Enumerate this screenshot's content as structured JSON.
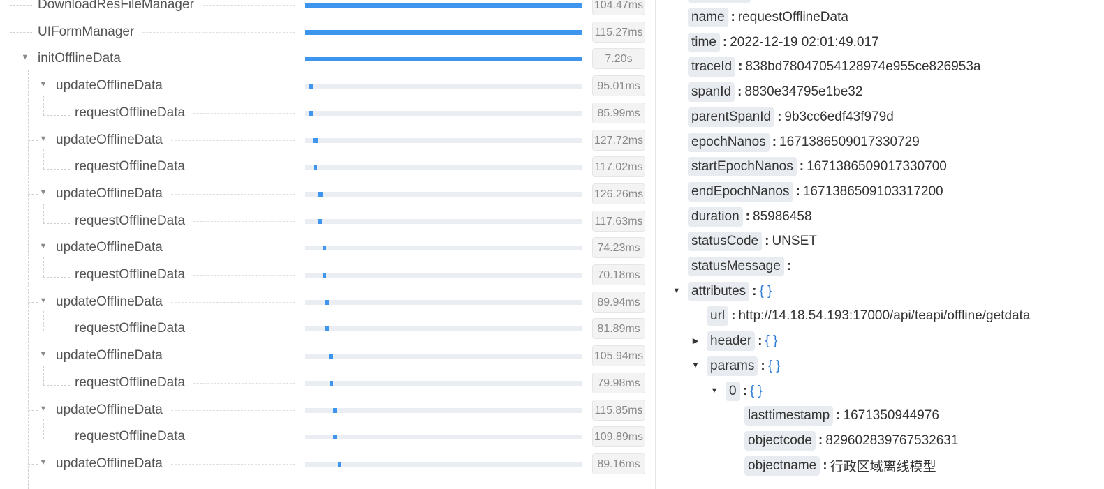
{
  "trace_tree": {
    "rows": [
      {
        "name": "DownloadResFileManager",
        "duration": "104.47ms",
        "depth": 0,
        "toggle": "none",
        "bar_start": 0.0,
        "bar_fill": 1.0,
        "partial": true
      },
      {
        "name": "UIFormManager",
        "duration": "115.27ms",
        "depth": 0,
        "toggle": "none",
        "bar_start": 0.0,
        "bar_fill": 1.0
      },
      {
        "name": "initOfflineData",
        "duration": "7.20s",
        "depth": 0,
        "toggle": "expanded",
        "bar_start": 0.0,
        "bar_fill": 1.0
      },
      {
        "name": "updateOfflineData",
        "duration": "95.01ms",
        "depth": 1,
        "toggle": "expanded",
        "bar_start": 0.015,
        "bar_fill": 0.013
      },
      {
        "name": "requestOfflineData",
        "duration": "85.99ms",
        "depth": 2,
        "toggle": "none",
        "bar_start": 0.016,
        "bar_fill": 0.011
      },
      {
        "name": "updateOfflineData",
        "duration": "127.72ms",
        "depth": 1,
        "toggle": "expanded",
        "bar_start": 0.028,
        "bar_fill": 0.017
      },
      {
        "name": "requestOfflineData",
        "duration": "117.02ms",
        "depth": 2,
        "toggle": "none",
        "bar_start": 0.029,
        "bar_fill": 0.015
      },
      {
        "name": "updateOfflineData",
        "duration": "126.26ms",
        "depth": 1,
        "toggle": "expanded",
        "bar_start": 0.045,
        "bar_fill": 0.017
      },
      {
        "name": "requestOfflineData",
        "duration": "117.63ms",
        "depth": 2,
        "toggle": "none",
        "bar_start": 0.046,
        "bar_fill": 0.015
      },
      {
        "name": "updateOfflineData",
        "duration": "74.23ms",
        "depth": 1,
        "toggle": "expanded",
        "bar_start": 0.063,
        "bar_fill": 0.01
      },
      {
        "name": "requestOfflineData",
        "duration": "70.18ms",
        "depth": 2,
        "toggle": "none",
        "bar_start": 0.063,
        "bar_fill": 0.009
      },
      {
        "name": "updateOfflineData",
        "duration": "89.94ms",
        "depth": 1,
        "toggle": "expanded",
        "bar_start": 0.073,
        "bar_fill": 0.012
      },
      {
        "name": "requestOfflineData",
        "duration": "81.89ms",
        "depth": 2,
        "toggle": "none",
        "bar_start": 0.074,
        "bar_fill": 0.011
      },
      {
        "name": "updateOfflineData",
        "duration": "105.94ms",
        "depth": 1,
        "toggle": "expanded",
        "bar_start": 0.086,
        "bar_fill": 0.014
      },
      {
        "name": "requestOfflineData",
        "duration": "79.98ms",
        "depth": 2,
        "toggle": "none",
        "bar_start": 0.087,
        "bar_fill": 0.011
      },
      {
        "name": "updateOfflineData",
        "duration": "115.85ms",
        "depth": 1,
        "toggle": "expanded",
        "bar_start": 0.101,
        "bar_fill": 0.015
      },
      {
        "name": "requestOfflineData",
        "duration": "109.89ms",
        "depth": 2,
        "toggle": "none",
        "bar_start": 0.102,
        "bar_fill": 0.014
      },
      {
        "name": "updateOfflineData",
        "duration": "89.16ms",
        "depth": 1,
        "toggle": "expanded",
        "bar_start": 0.118,
        "bar_fill": 0.012
      }
    ]
  },
  "details": {
    "rows": [
      {
        "key": "name",
        "value": "requestOfflineData",
        "indent": 0
      },
      {
        "key": "time",
        "value": "2022-12-19 02:01:49.017",
        "indent": 0
      },
      {
        "key": "traceId",
        "value": "838bd78047054128974e955ce826953a",
        "indent": 0
      },
      {
        "key": "spanId",
        "value": "8830e34795e1be32",
        "indent": 0
      },
      {
        "key": "parentSpanId",
        "value": "9b3cc6edf43f979d",
        "indent": 0
      },
      {
        "key": "epochNanos",
        "value": "1671386509017330729",
        "indent": 0
      },
      {
        "key": "startEpochNanos",
        "value": "1671386509017330700",
        "indent": 0
      },
      {
        "key": "endEpochNanos",
        "value": "1671386509103317200",
        "indent": 0
      },
      {
        "key": "duration",
        "value": "85986458",
        "indent": 0
      },
      {
        "key": "statusCode",
        "value": "UNSET",
        "indent": 0
      },
      {
        "key": "statusMessage",
        "value": "",
        "indent": 0
      },
      {
        "key": "attributes",
        "brace": "{ }",
        "indent": 0,
        "arrow": "expanded"
      },
      {
        "key": "url",
        "value": "http://14.18.54.193:17000/api/teapi/offline/getdata",
        "indent": 1
      },
      {
        "key": "header",
        "brace": "{ }",
        "indent": 1,
        "arrow": "collapsed"
      },
      {
        "key": "params",
        "brace": "{ }",
        "indent": 1,
        "arrow": "expanded"
      },
      {
        "key": "0",
        "brace": "{ }",
        "indent": 2,
        "arrow": "expanded"
      },
      {
        "key": "lasttimestamp",
        "value": "1671350944976",
        "indent": 3
      },
      {
        "key": "objectcode",
        "value": "829602839767532631",
        "indent": 3
      },
      {
        "key": "objectname",
        "value": "行政区域离线模型",
        "indent": 3
      }
    ]
  },
  "colors": {
    "bar_fill": "#3e95ee",
    "bar_track": "#eaeef3",
    "key_bg": "#e8ecf0",
    "brace": "#2a7ad6"
  }
}
